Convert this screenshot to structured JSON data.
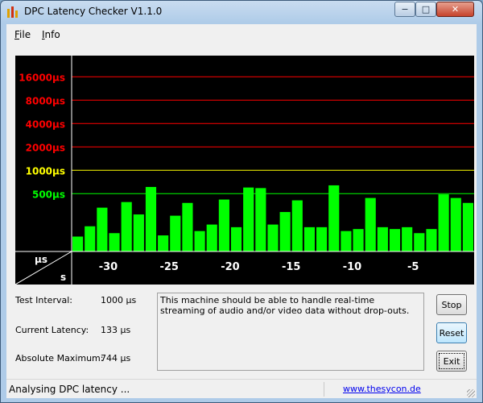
{
  "window": {
    "title": "DPC Latency Checker V1.1.0",
    "controls": {
      "minimize": "−",
      "maximize": "□",
      "close": "✕"
    }
  },
  "menu": [
    {
      "label": "File"
    },
    {
      "label": "Info"
    }
  ],
  "chart_data": {
    "type": "bar",
    "y_scale": "log",
    "y_unit": "µs",
    "x_unit": "s",
    "y_axis_unit_label": "µs",
    "x_axis_unit_label": "s",
    "y_ticks": [
      {
        "label": "500µs",
        "value": 500,
        "color": "#00ff00"
      },
      {
        "label": "1000µs",
        "value": 1000,
        "color": "#ffff00"
      },
      {
        "label": "2000µs",
        "value": 2000,
        "color": "#ff0000"
      },
      {
        "label": "4000µs",
        "value": 4000,
        "color": "#ff0000"
      },
      {
        "label": "8000µs",
        "value": 8000,
        "color": "#ff0000"
      },
      {
        "label": "16000µs",
        "value": 16000,
        "color": "#ff0000"
      }
    ],
    "x_range": [
      -33,
      0
    ],
    "x_ticks": [
      -30,
      -25,
      -20,
      -15,
      -10,
      -5
    ],
    "ylim": [
      90,
      30000
    ],
    "bar_color": "#00ff00",
    "background": "#000000",
    "values": [
      140,
      190,
      330,
      155,
      390,
      270,
      610,
      145,
      260,
      380,
      165,
      200,
      420,
      185,
      600,
      590,
      200,
      290,
      410,
      185,
      185,
      640,
      165,
      175,
      440,
      185,
      175,
      185,
      155,
      175,
      490,
      440,
      380
    ]
  },
  "stats": {
    "test_interval": {
      "label": "Test Interval:",
      "value": "1000 µs"
    },
    "current_latency": {
      "label": "Current Latency:",
      "value": "133 µs"
    },
    "absolute_maximum": {
      "label": "Absolute Maximum:",
      "value": "744 µs"
    }
  },
  "message": "This machine should be able to handle real-time streaming of audio and/or video data without drop-outs.",
  "buttons": {
    "stop": "Stop",
    "reset": "Reset",
    "exit": "Exit"
  },
  "status": {
    "text": "Analysing DPC latency ...",
    "link": "www.thesycon.de"
  }
}
